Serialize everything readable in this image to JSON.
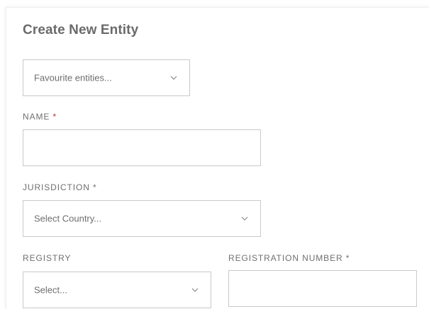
{
  "form": {
    "title": "Create New Entity",
    "favourites": {
      "placeholder": "Favourite entities..."
    },
    "name": {
      "label": "NAME",
      "required_mark": "*",
      "value": ""
    },
    "jurisdiction": {
      "label": "JURISDICTION",
      "required_mark": "*",
      "placeholder": "Select Country..."
    },
    "registry": {
      "label": "REGISTRY",
      "placeholder": "Select..."
    },
    "registration_number": {
      "label": "REGISTRATION NUMBER",
      "required_mark": "*",
      "value": ""
    }
  },
  "colors": {
    "required_accent": "#d22b2b",
    "border": "#c9c9c9",
    "text": "#6f6f6f"
  },
  "icons": {
    "dropdown": "chevron-down-icon"
  }
}
